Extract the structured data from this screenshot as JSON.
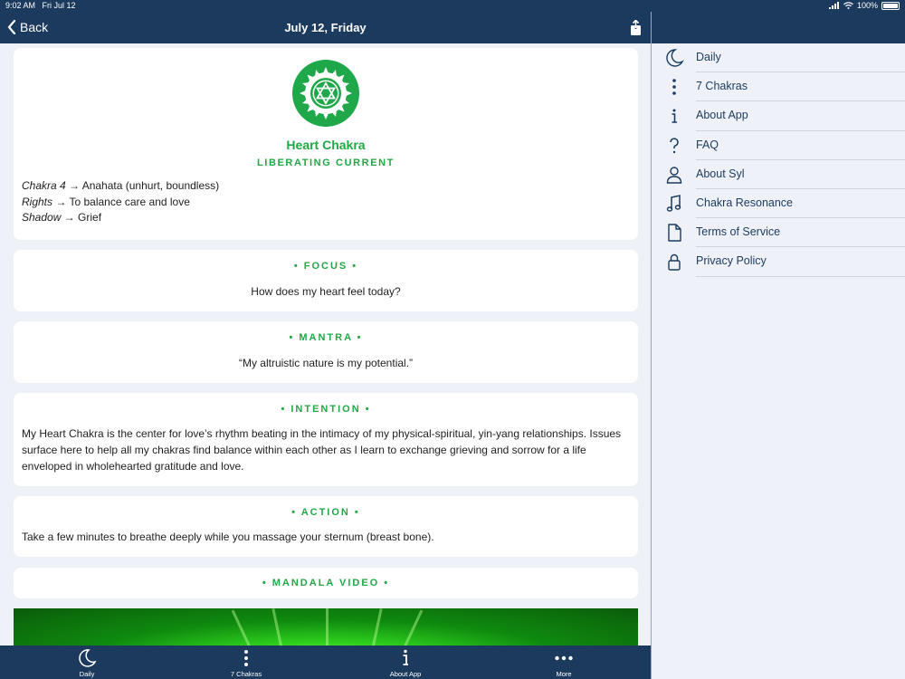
{
  "status": {
    "time": "9:02 AM",
    "date": "Fri Jul 12",
    "battery": "100%"
  },
  "nav": {
    "back_label": "Back",
    "title": "July 12, Friday"
  },
  "chakra": {
    "name": "Heart Chakra",
    "subtitle": "LIBERATING CURRENT",
    "lines": [
      {
        "term": "Chakra 4",
        "value": " → Anahata (unhurt, boundless)"
      },
      {
        "term": "Rights",
        "value": " → To balance care and love"
      },
      {
        "term": "Shadow",
        "value": " → Grief"
      }
    ]
  },
  "focus": {
    "heading": "• FOCUS •",
    "text": "How does my heart feel today?"
  },
  "mantra": {
    "heading": "• MANTRA •",
    "text": "“My altruistic nature is my potential.”"
  },
  "intention": {
    "heading": "• INTENTION •",
    "text": "My Heart Chakra is the center for love’s rhythm beating in the intimacy of my physical-spiritual, yin-yang relationships. Issues surface here to help all my chakras find balance within each other as I learn to exchange grieving and sorrow for a life enveloped in wholehearted gratitude and love."
  },
  "action": {
    "heading": "• ACTION •",
    "text": "Take a few minutes to breathe deeply while you massage your sternum (breast bone)."
  },
  "mandala": {
    "heading": "• MANDALA VIDEO •"
  },
  "tabs": [
    {
      "label": "Daily",
      "icon": "moon-icon"
    },
    {
      "label": "7 Chakras",
      "icon": "vertical-dots-icon"
    },
    {
      "label": "About App",
      "icon": "info-icon"
    },
    {
      "label": "More",
      "icon": "more-dots-icon"
    }
  ],
  "menu": [
    {
      "label": "Daily",
      "icon": "moon-icon"
    },
    {
      "label": "7 Chakras",
      "icon": "vertical-dots-icon"
    },
    {
      "label": "About App",
      "icon": "info-icon"
    },
    {
      "label": "FAQ",
      "icon": "question-icon"
    },
    {
      "label": "About Syl",
      "icon": "person-icon"
    },
    {
      "label": "Chakra Resonance",
      "icon": "music-note-icon"
    },
    {
      "label": "Terms of Service",
      "icon": "document-icon"
    },
    {
      "label": "Privacy Policy",
      "icon": "lock-icon"
    }
  ],
  "colors": {
    "navy": "#1b3a5e",
    "accent_green": "#22a746",
    "background": "#eef2f8"
  }
}
